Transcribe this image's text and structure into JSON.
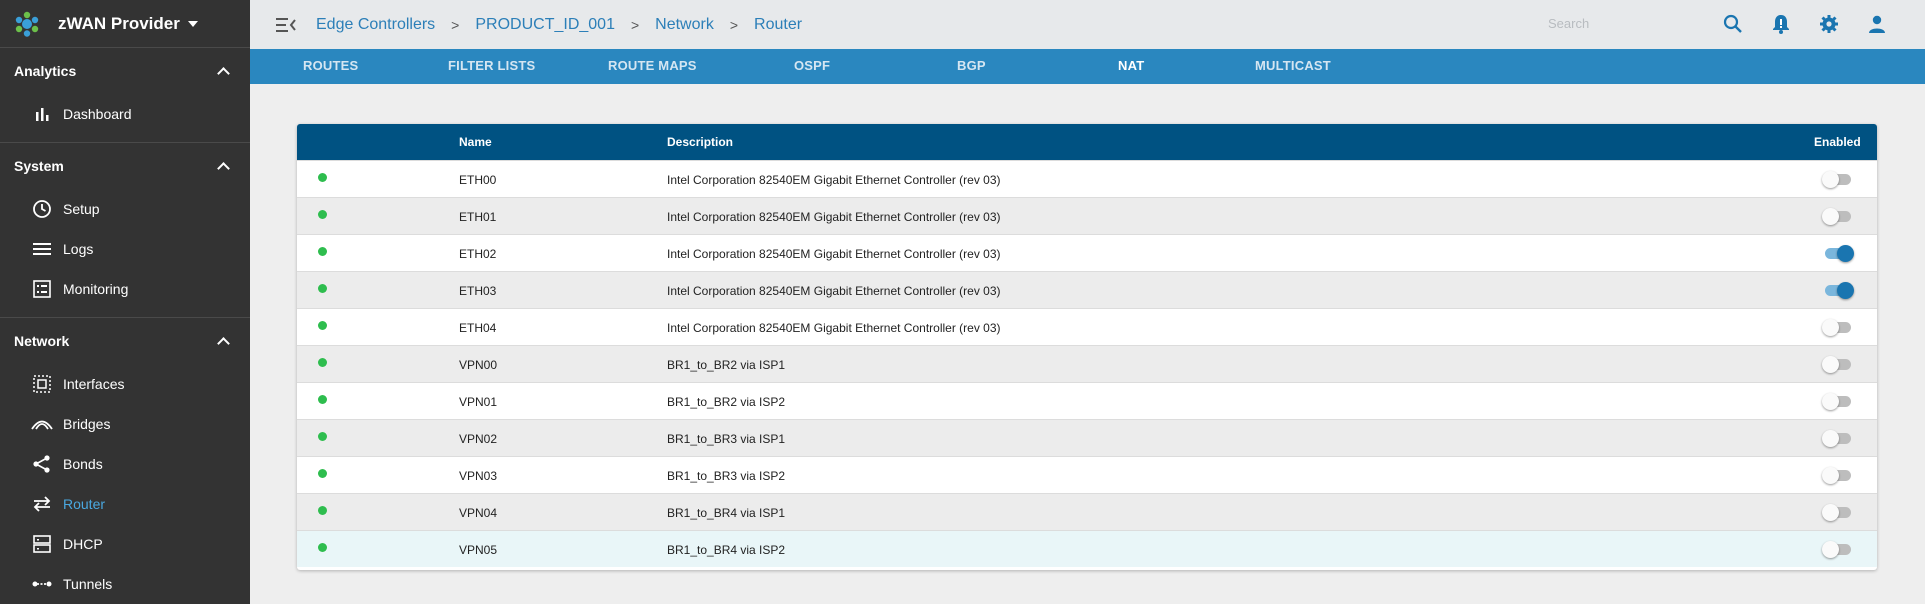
{
  "app": {
    "title": "zWAN Provider"
  },
  "colors": {
    "accent": "#2a87bf",
    "header": "#005282",
    "status_ok": "#2ebd4e",
    "active_nav": "#4aa8e0"
  },
  "sidebar": {
    "sections": [
      {
        "label": "Analytics",
        "items": [
          {
            "label": "Dashboard",
            "icon": "bar-chart-icon"
          }
        ]
      },
      {
        "label": "System",
        "items": [
          {
            "label": "Setup",
            "icon": "clock-icon"
          },
          {
            "label": "Logs",
            "icon": "lines-icon"
          },
          {
            "label": "Monitoring",
            "icon": "list-box-icon"
          }
        ]
      },
      {
        "label": "Network",
        "items": [
          {
            "label": "Interfaces",
            "icon": "interfaces-icon"
          },
          {
            "label": "Bridges",
            "icon": "bridge-icon"
          },
          {
            "label": "Bonds",
            "icon": "share-icon"
          },
          {
            "label": "Router",
            "icon": "swap-arrows-icon",
            "active": true
          },
          {
            "label": "DHCP",
            "icon": "server-icon"
          },
          {
            "label": "Tunnels",
            "icon": "tunnel-icon"
          }
        ]
      }
    ]
  },
  "breadcrumb": [
    "Edge Controllers",
    "PRODUCT_ID_001",
    "Network",
    "Router"
  ],
  "search": {
    "placeholder": "Search",
    "value": ""
  },
  "tabs": [
    {
      "label": "ROUTES",
      "active": false
    },
    {
      "label": "FILTER LISTS",
      "active": false
    },
    {
      "label": "ROUTE MAPS",
      "active": false
    },
    {
      "label": "OSPF",
      "active": false
    },
    {
      "label": "BGP",
      "active": false
    },
    {
      "label": "NAT",
      "active": true
    },
    {
      "label": "MULTICAST",
      "active": false
    }
  ],
  "table": {
    "columns": {
      "name": "Name",
      "description": "Description",
      "enabled": "Enabled"
    },
    "rows": [
      {
        "name": "ETH00",
        "description": "Intel Corporation 82540EM Gigabit Ethernet Controller (rev 03)",
        "enabled": false
      },
      {
        "name": "ETH01",
        "description": "Intel Corporation 82540EM Gigabit Ethernet Controller (rev 03)",
        "enabled": false
      },
      {
        "name": "ETH02",
        "description": "Intel Corporation 82540EM Gigabit Ethernet Controller (rev 03)",
        "enabled": true
      },
      {
        "name": "ETH03",
        "description": "Intel Corporation 82540EM Gigabit Ethernet Controller (rev 03)",
        "enabled": true
      },
      {
        "name": "ETH04",
        "description": "Intel Corporation 82540EM Gigabit Ethernet Controller (rev 03)",
        "enabled": false
      },
      {
        "name": "VPN00",
        "description": "BR1_to_BR2 via ISP1",
        "enabled": false
      },
      {
        "name": "VPN01",
        "description": "BR1_to_BR2 via ISP2",
        "enabled": false
      },
      {
        "name": "VPN02",
        "description": "BR1_to_BR3 via ISP1",
        "enabled": false
      },
      {
        "name": "VPN03",
        "description": "BR1_to_BR3 via ISP2",
        "enabled": false
      },
      {
        "name": "VPN04",
        "description": "BR1_to_BR4 via ISP1",
        "enabled": false
      },
      {
        "name": "VPN05",
        "description": "BR1_to_BR4 via ISP2",
        "enabled": false
      }
    ]
  }
}
